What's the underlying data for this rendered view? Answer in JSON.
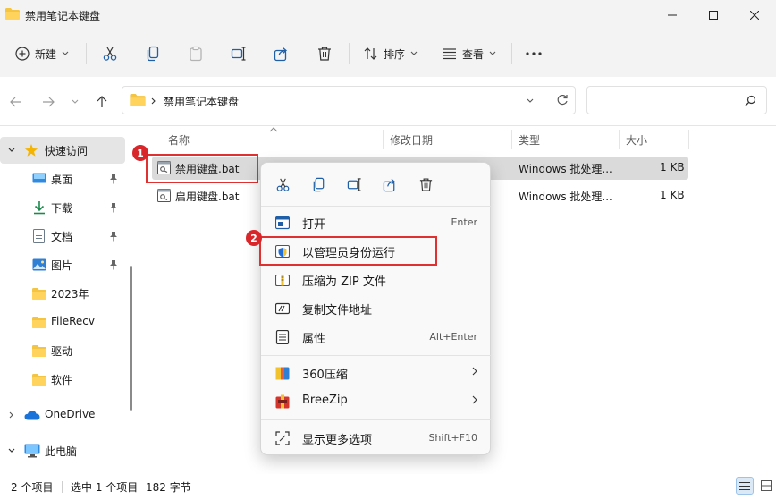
{
  "window": {
    "title": "禁用笔记本键盘"
  },
  "toolbar": {
    "new_label": "新建",
    "sort_label": "排序",
    "view_label": "查看"
  },
  "address": {
    "path": "禁用笔记本键盘"
  },
  "sidebar": {
    "quick_access": "快速访问",
    "items": [
      {
        "label": "桌面"
      },
      {
        "label": "下载"
      },
      {
        "label": "文档"
      },
      {
        "label": "图片"
      },
      {
        "label": "2023年"
      },
      {
        "label": "FileRecv"
      },
      {
        "label": "驱动"
      },
      {
        "label": "软件"
      }
    ],
    "onedrive": "OneDrive",
    "this_pc": "此电脑"
  },
  "columns": {
    "name": "名称",
    "modified": "修改日期",
    "type": "类型",
    "size": "大小"
  },
  "files": [
    {
      "name": "禁用键盘.bat",
      "type": "Windows 批处理...",
      "size": "1 KB"
    },
    {
      "name": "启用键盘.bat",
      "type": "Windows 批处理...",
      "size": "1 KB"
    }
  ],
  "badges": {
    "one": "1",
    "two": "2"
  },
  "context_menu": {
    "open": {
      "label": "打开",
      "shortcut": "Enter"
    },
    "run_admin": {
      "label": "以管理员身份运行"
    },
    "zip": {
      "label": "压缩为 ZIP 文件"
    },
    "copy_path": {
      "label": "复制文件地址"
    },
    "properties": {
      "label": "属性",
      "shortcut": "Alt+Enter"
    },
    "zip360": {
      "label": "360压缩"
    },
    "breezip": {
      "label": "BreeZip"
    },
    "more": {
      "label": "显示更多选项",
      "shortcut": "Shift+F10"
    }
  },
  "status": {
    "count": "2 个项目",
    "selected": "选中 1 个项目",
    "bytes": "182 字节"
  },
  "colors": {
    "accent": "#005fb8",
    "folder": "#f4c542",
    "highlight": "#e03131"
  }
}
